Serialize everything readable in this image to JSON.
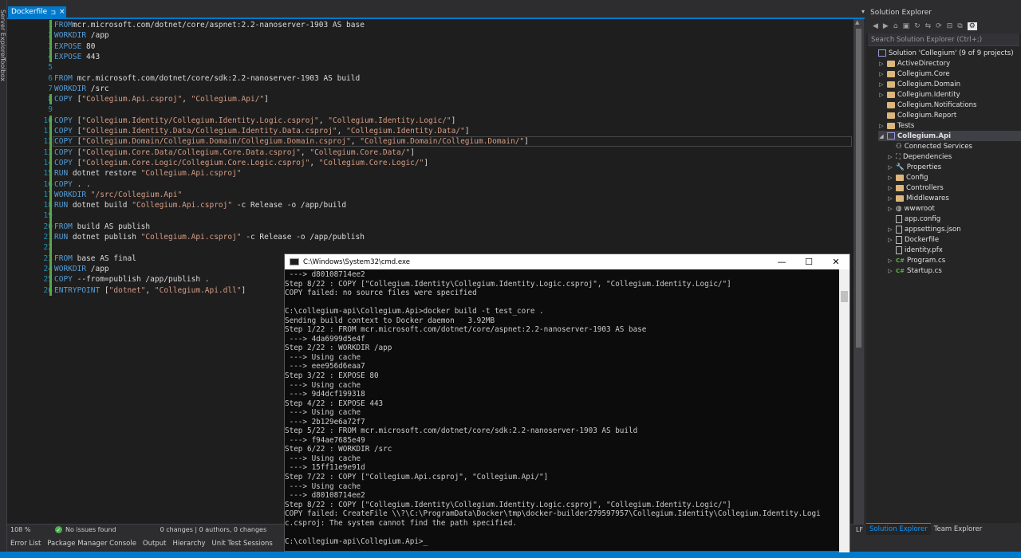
{
  "left_rail": {
    "labels": [
      "Server Explorer",
      "Toolbox"
    ]
  },
  "editor": {
    "tab_label": "Dockerfile",
    "tab_pin": "⊐",
    "tab_close": "×",
    "tab_dropdown": "▾",
    "lines": [
      {
        "n": "1",
        "parts": [
          [
            "kw",
            "FROM"
          ],
          [
            "",
            "mcr.microsoft.com/dotnet/core/aspnet:2.2-nanoserver-1903 AS base"
          ]
        ]
      },
      {
        "n": "2",
        "parts": [
          [
            "kw",
            "WORKDIR"
          ],
          [
            "",
            " /app"
          ]
        ]
      },
      {
        "n": "3",
        "parts": [
          [
            "kw",
            "EXPOSE"
          ],
          [
            "",
            " 80"
          ]
        ]
      },
      {
        "n": "4",
        "parts": [
          [
            "kw",
            "EXPOSE"
          ],
          [
            "",
            " 443"
          ]
        ]
      },
      {
        "n": "5",
        "parts": []
      },
      {
        "n": "6",
        "parts": [
          [
            "kw",
            "FROM"
          ],
          [
            "",
            " mcr.microsoft.com/dotnet/core/sdk:2.2-nanoserver-1903 AS build"
          ]
        ]
      },
      {
        "n": "7",
        "parts": [
          [
            "kw",
            "WORKDIR"
          ],
          [
            "",
            " /src"
          ]
        ]
      },
      {
        "n": "8",
        "parts": [
          [
            "kw",
            "COPY"
          ],
          [
            "",
            " ["
          ],
          [
            "str",
            "\"Collegium.Api.csproj\""
          ],
          [
            "",
            ", "
          ],
          [
            "str",
            "\"Collegium.Api/\""
          ],
          [
            "",
            "]"
          ]
        ]
      },
      {
        "n": "9",
        "parts": []
      },
      {
        "n": "10",
        "parts": [
          [
            "kw",
            "COPY"
          ],
          [
            "",
            " ["
          ],
          [
            "str",
            "\"Collegium.Identity/Collegium.Identity.Logic.csproj\""
          ],
          [
            "",
            ", "
          ],
          [
            "str",
            "\"Collegium.Identity.Logic/\""
          ],
          [
            "",
            "]"
          ]
        ]
      },
      {
        "n": "11",
        "parts": [
          [
            "kw",
            "COPY"
          ],
          [
            "",
            " ["
          ],
          [
            "str",
            "\"Collegium.Identity.Data/Collegium.Identity.Data.csproj\""
          ],
          [
            "",
            ", "
          ],
          [
            "str",
            "\"Collegium.Identity.Data/\""
          ],
          [
            "",
            "]"
          ]
        ]
      },
      {
        "n": "12",
        "parts": [
          [
            "kw",
            "COPY"
          ],
          [
            "",
            " ["
          ],
          [
            "str",
            "\"Collegium.Domain/Collegium.Domain/Collegium.Domain.csproj\""
          ],
          [
            "",
            ", "
          ],
          [
            "str",
            "\"Collegium.Domain/Collegium.Domain/\""
          ],
          [
            "",
            "]"
          ]
        ]
      },
      {
        "n": "13",
        "parts": [
          [
            "kw",
            "COPY"
          ],
          [
            "",
            " ["
          ],
          [
            "str",
            "\"Collegium.Core.Data/Collegium.Core.Data.csproj\""
          ],
          [
            "",
            ", "
          ],
          [
            "str",
            "\"Collegium.Core.Data/\""
          ],
          [
            "",
            "]"
          ]
        ]
      },
      {
        "n": "14",
        "parts": [
          [
            "kw",
            "COPY"
          ],
          [
            "",
            " ["
          ],
          [
            "str",
            "\"Collegium.Core.Logic/Collegium.Core.Logic.csproj\""
          ],
          [
            "",
            ", "
          ],
          [
            "str",
            "\"Collegium.Core.Logic/\""
          ],
          [
            "",
            "]"
          ]
        ]
      },
      {
        "n": "15",
        "parts": [
          [
            "kw",
            "RUN"
          ],
          [
            "",
            " dotnet restore "
          ],
          [
            "str",
            "\"Collegium.Api.csproj\""
          ]
        ]
      },
      {
        "n": "16",
        "parts": [
          [
            "kw",
            "COPY"
          ],
          [
            "",
            " . ."
          ]
        ]
      },
      {
        "n": "17",
        "parts": [
          [
            "kw",
            "WORKDIR"
          ],
          [
            "",
            " "
          ],
          [
            "str",
            "\"/src/Collegium.Api\""
          ]
        ]
      },
      {
        "n": "18",
        "parts": [
          [
            "kw",
            "RUN"
          ],
          [
            "",
            " dotnet build "
          ],
          [
            "str",
            "\"Collegium.Api.csproj\""
          ],
          [
            "",
            " -c Release -o /app/build"
          ]
        ]
      },
      {
        "n": "19",
        "parts": []
      },
      {
        "n": "20",
        "parts": [
          [
            "kw",
            "FROM"
          ],
          [
            "",
            " build AS publish"
          ]
        ]
      },
      {
        "n": "21",
        "parts": [
          [
            "kw",
            "RUN"
          ],
          [
            "",
            " dotnet publish "
          ],
          [
            "str",
            "\"Collegium.Api.csproj\""
          ],
          [
            "",
            " -c Release -o /app/publish"
          ]
        ]
      },
      {
        "n": "22",
        "parts": []
      },
      {
        "n": "23",
        "parts": [
          [
            "kw",
            "FROM"
          ],
          [
            "",
            " base AS final"
          ]
        ]
      },
      {
        "n": "24",
        "parts": [
          [
            "kw",
            "WORKDIR"
          ],
          [
            "",
            " /app"
          ]
        ]
      },
      {
        "n": "25",
        "parts": [
          [
            "kw",
            "COPY"
          ],
          [
            "",
            " --from=publish /app/publish ."
          ]
        ]
      },
      {
        "n": "26",
        "parts": [
          [
            "kw",
            "ENTRYPOINT"
          ],
          [
            "",
            " ["
          ],
          [
            "str",
            "\"dotnet\""
          ],
          [
            "",
            ", "
          ],
          [
            "str",
            "\"Collegium.Api.dll\""
          ],
          [
            "",
            "]"
          ]
        ]
      }
    ]
  },
  "status": {
    "zoom": "108 %",
    "issues": "No issues found",
    "changes": "0 changes | 0 authors, 0 changes",
    "eol": "LF"
  },
  "tool_tabs": [
    "Error List",
    "Package Manager Console",
    "Output",
    "Hierarchy",
    "Unit Test Sessions"
  ],
  "solution_explorer": {
    "title": "Solution Explorer",
    "search_placeholder": "Search Solution Explorer (Ctrl+;)",
    "items": [
      {
        "label": "Solution 'Collegium' (9 of 9 projects)",
        "kind": "solution",
        "arrow": "",
        "indent": 0
      },
      {
        "label": "ActiveDirectory",
        "kind": "folder",
        "arrow": "▷",
        "indent": 1
      },
      {
        "label": "Collegium.Core",
        "kind": "folder",
        "arrow": "▷",
        "indent": 1
      },
      {
        "label": "Collegium.Domain",
        "kind": "folder",
        "arrow": "▷",
        "indent": 1
      },
      {
        "label": "Collegium.Identity",
        "kind": "folder",
        "arrow": "▷",
        "indent": 1
      },
      {
        "label": "Collegium.Notifications",
        "kind": "folder",
        "arrow": "",
        "indent": 1
      },
      {
        "label": "Collegium.Report",
        "kind": "folder",
        "arrow": "",
        "indent": 1
      },
      {
        "label": "Tests",
        "kind": "folder",
        "arrow": "▷",
        "indent": 1
      },
      {
        "label": "Collegium.Api",
        "kind": "project",
        "arrow": "◢",
        "indent": 1
      },
      {
        "label": "Connected Services",
        "kind": "service",
        "arrow": "",
        "indent": 2
      },
      {
        "label": "Dependencies",
        "kind": "deps",
        "arrow": "▷",
        "indent": 2
      },
      {
        "label": "Properties",
        "kind": "props",
        "arrow": "▷",
        "indent": 2
      },
      {
        "label": "Config",
        "kind": "folder",
        "arrow": "▷",
        "indent": 2
      },
      {
        "label": "Controllers",
        "kind": "folder",
        "arrow": "▷",
        "indent": 2
      },
      {
        "label": "Middlewares",
        "kind": "folder",
        "arrow": "▷",
        "indent": 2
      },
      {
        "label": "wwwroot",
        "kind": "web",
        "arrow": "▷",
        "indent": 2
      },
      {
        "label": "app.config",
        "kind": "file",
        "arrow": "",
        "indent": 2
      },
      {
        "label": "appsettings.json",
        "kind": "file",
        "arrow": "▷",
        "indent": 2
      },
      {
        "label": "Dockerfile",
        "kind": "file",
        "arrow": "▷",
        "indent": 2
      },
      {
        "label": "identity.pfx",
        "kind": "file",
        "arrow": "",
        "indent": 2
      },
      {
        "label": "Program.cs",
        "kind": "cs",
        "arrow": "▷",
        "indent": 2
      },
      {
        "label": "Startup.cs",
        "kind": "cs",
        "arrow": "▷",
        "indent": 2
      }
    ],
    "bottom_tabs": [
      "Solution Explorer",
      "Team Explorer"
    ]
  },
  "console": {
    "title": "C:\\Windows\\System32\\cmd.exe",
    "minimize": "—",
    "maximize": "☐",
    "close": "✕",
    "lines": [
      " ---> d80108714ee2",
      "Step 8/22 : COPY [\"Collegium.Identity\\Collegium.Identity.Logic.csproj\", \"Collegium.Identity.Logic/\"]",
      "COPY failed: no source files were specified",
      "",
      "C:\\collegium-api\\Collegium.Api>docker build -t test_core .",
      "Sending build context to Docker daemon   3.92MB",
      "Step 1/22 : FROM mcr.microsoft.com/dotnet/core/aspnet:2.2-nanoserver-1903 AS base",
      " ---> 4da6999d5e4f",
      "Step 2/22 : WORKDIR /app",
      " ---> Using cache",
      " ---> eee956d6eaa7",
      "Step 3/22 : EXPOSE 80",
      " ---> Using cache",
      " ---> 9d4dcf199318",
      "Step 4/22 : EXPOSE 443",
      " ---> Using cache",
      " ---> 2b129e6a72f7",
      "Step 5/22 : FROM mcr.microsoft.com/dotnet/core/sdk:2.2-nanoserver-1903 AS build",
      " ---> f94ae7685e49",
      "Step 6/22 : WORKDIR /src",
      " ---> Using cache",
      " ---> 15ff11e9e91d",
      "Step 7/22 : COPY [\"Collegium.Api.csproj\", \"Collegium.Api/\"]",
      " ---> Using cache",
      " ---> d80108714ee2",
      "Step 8/22 : COPY [\"Collegium.Identity\\Collegium.Identity.Logic.csproj\", \"Collegium.Identity.Logic/\"]",
      "COPY failed: CreateFile \\\\?\\C:\\ProgramData\\Docker\\tmp\\docker-builder279597957\\Collegium.Identity\\Collegium.Identity.Logi",
      "c.csproj: The system cannot find the path specified.",
      "",
      "C:\\collegium-api\\Collegium.Api>"
    ]
  },
  "colors": {
    "accent": "#007acc",
    "keyword": "#569cd6",
    "string": "#d69d85",
    "line_number": "#2b91af"
  }
}
